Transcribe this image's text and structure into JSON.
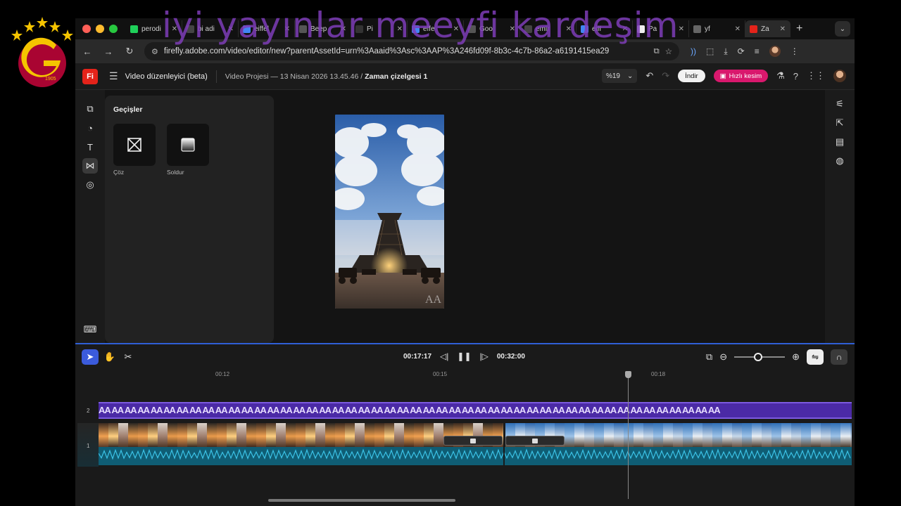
{
  "overlay_caption": "iyi yayınlar meeyfi kardeşim",
  "logo": {
    "year": "1905",
    "name": "Galatasaray"
  },
  "window_controls": [
    "close",
    "minimize",
    "maximize"
  ],
  "tabs": [
    {
      "label": "perodi",
      "favicon": "k-icon",
      "color": "#1fd05a"
    },
    {
      "label": "bi adi",
      "favicon": "sparkle-icon",
      "color": "#444"
    },
    {
      "label": "eiffel",
      "favicon": "google-icon",
      "color": "#4285f4"
    },
    {
      "label": "Beep",
      "favicon": "g-icon",
      "color": "#555"
    },
    {
      "label": "Pi",
      "favicon": "p-icon",
      "color": "#333"
    },
    {
      "label": "effe",
      "favicon": "google-icon",
      "color": "#4285f4"
    },
    {
      "label": "Goo",
      "favicon": "g-icon",
      "color": "#555"
    },
    {
      "label": "emir",
      "favicon": "page-icon",
      "color": "#444"
    },
    {
      "label": "eiff",
      "favicon": "google-icon",
      "color": "#4285f4"
    },
    {
      "label": "Pa",
      "favicon": "doc-icon",
      "color": "#eee"
    },
    {
      "label": "yf",
      "favicon": "image-icon",
      "color": "#666"
    },
    {
      "label": "Za",
      "favicon": "firefly-icon",
      "color": "#e4231a",
      "active": true
    }
  ],
  "address": {
    "url": "firefly.adobe.com/video/editor/new?parentAssetId=urn%3Aaaid%3Asc%3AAP%3A246fd09f-8b3c-4c7b-86a2-a6191415ea29"
  },
  "app": {
    "logo_text": "Fi",
    "name": "Video düzenleyici (beta)",
    "project": "Video Projesi — 13 Nisan 2026 13.45.46",
    "timeline_name": "Zaman çizelgesi 1",
    "zoom": "%19",
    "download_label": "İndir",
    "quickcut_label": "Hızlı kesim"
  },
  "panel": {
    "title": "Geçişler",
    "items": [
      {
        "label": "Çöz",
        "icon": "dissolve-icon"
      },
      {
        "label": "Soldur",
        "icon": "fade-icon"
      }
    ]
  },
  "timeline": {
    "current_time": "00:17:17",
    "total_time": "00:32:00",
    "ruler": [
      "00:12",
      "00:15",
      "00:18"
    ],
    "tracks": [
      {
        "number": "2",
        "label": "text-track"
      },
      {
        "number": "1",
        "label": "video-track"
      }
    ],
    "overlay_glyph": "AA"
  },
  "colors": {
    "accent_blue": "#3b5bdb",
    "quickcut_pink": "#d9186d",
    "firefly_red": "#e4231a",
    "text_track_purple": "#4b2aa6",
    "audio_teal": "#0f5d74"
  }
}
